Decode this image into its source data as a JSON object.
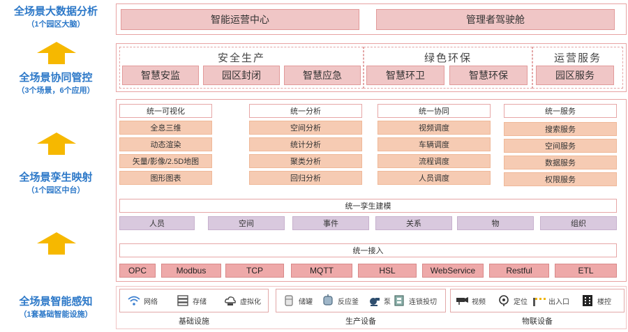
{
  "layers": [
    {
      "title": "全场景大数据分析",
      "subtitle": "（1个园区大脑）"
    },
    {
      "title": "全场景协同管控",
      "subtitle": "（3个场景，6个应用）"
    },
    {
      "title": "全场景孪生映射",
      "subtitle": "（1个园区中台）"
    },
    {
      "title": "全场景智能感知",
      "subtitle": "（1套基础智能设施）"
    }
  ],
  "top": {
    "items": [
      "智能运营中心",
      "管理者驾驶舱"
    ]
  },
  "collab": {
    "groups": [
      {
        "title": "安全生产",
        "apps": [
          "智慧安监",
          "园区封闭",
          "智慧应急"
        ]
      },
      {
        "title": "绿色环保",
        "apps": [
          "智慧环卫",
          "智慧环保"
        ]
      },
      {
        "title": "运营服务",
        "apps": [
          "园区服务"
        ]
      }
    ]
  },
  "twin": {
    "columns": [
      {
        "head": "统一可视化",
        "items": [
          "全息三维",
          "动态渲染",
          "矢量/影像/2.5D地图",
          "图形图表"
        ]
      },
      {
        "head": "统一分析",
        "items": [
          "空间分析",
          "统计分析",
          "聚类分析",
          "回归分析"
        ]
      },
      {
        "head": "统一协同",
        "items": [
          "视频调度",
          "车辆调度",
          "流程调度",
          "人员调度"
        ]
      },
      {
        "head": "统一服务",
        "items": [
          "搜索服务",
          "空间服务",
          "数据服务",
          "权限服务"
        ]
      }
    ],
    "modeling": "统一孪生建模",
    "entities": [
      "人员",
      "空间",
      "事件",
      "关系",
      "物",
      "组织"
    ],
    "access": "统一接入",
    "protocols": [
      "OPC",
      "Modbus",
      "TCP",
      "MQTT",
      "HSL",
      "WebService",
      "Restful",
      "ETL"
    ]
  },
  "sense": {
    "groups": [
      {
        "label": "基础设施",
        "items": [
          {
            "name": "网络",
            "icon": "wifi-icon"
          },
          {
            "name": "存储",
            "icon": "storage-icon"
          },
          {
            "name": "虚拟化",
            "icon": "cloud-icon"
          }
        ]
      },
      {
        "label": "生产设备",
        "items": [
          {
            "name": "储罐",
            "icon": "tank-icon"
          },
          {
            "name": "反应釜",
            "icon": "reactor-icon"
          },
          {
            "name": "泵",
            "icon": "pump-icon"
          },
          {
            "name": "连锁投切",
            "icon": "switch-icon"
          }
        ]
      },
      {
        "label": "物联设备",
        "items": [
          {
            "name": "视频",
            "icon": "camera-icon"
          },
          {
            "name": "定位",
            "icon": "locate-icon"
          },
          {
            "name": "出入口",
            "icon": "gate-icon"
          },
          {
            "name": "楼控",
            "icon": "building-icon"
          }
        ]
      }
    ]
  },
  "colors": {
    "accent": "#2c78c8",
    "arrow": "#f6b800",
    "panel_border": "#e7a3a3"
  }
}
